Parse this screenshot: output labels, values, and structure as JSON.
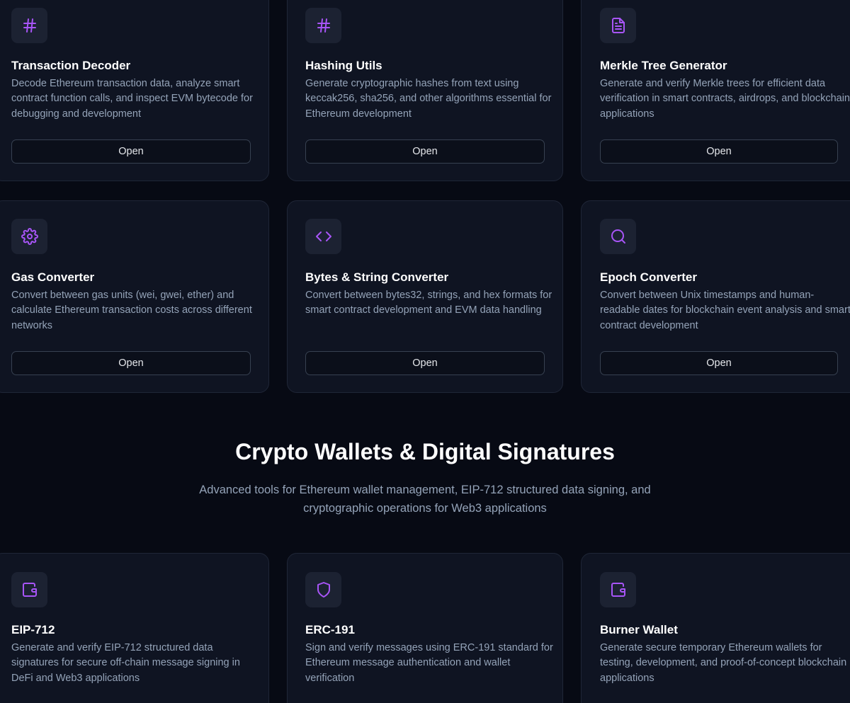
{
  "tools_grid": [
    {
      "title": "Transaction Decoder",
      "description": "Decode Ethereum transaction data, analyze smart contract function calls, and inspect EVM bytecode for debugging and development",
      "button": "Open",
      "icon": "hash-icon"
    },
    {
      "title": "Hashing Utils",
      "description": "Generate cryptographic hashes from text using keccak256, sha256, and other algorithms essential for Ethereum development",
      "button": "Open",
      "icon": "hash-icon"
    },
    {
      "title": "Merkle Tree Generator",
      "description": "Generate and verify Merkle trees for efficient data verification in smart contracts, airdrops, and blockchain applications",
      "button": "Open",
      "icon": "file-text-icon"
    },
    {
      "title": "Gas Converter",
      "description": "Convert between gas units (wei, gwei, ether) and calculate Ethereum transaction costs across different networks",
      "button": "Open",
      "icon": "gear-icon"
    },
    {
      "title": "Bytes & String Converter",
      "description": "Convert between bytes32, strings, and hex formats for smart contract development and EVM data handling",
      "button": "Open",
      "icon": "code-icon"
    },
    {
      "title": "Epoch Converter",
      "description": "Convert between Unix timestamps and human-readable dates for blockchain event analysis and smart contract development",
      "button": "Open",
      "icon": "search-icon"
    }
  ],
  "wallets_section": {
    "title": "Crypto Wallets & Digital Signatures",
    "subtitle_line1": "Advanced tools for Ethereum wallet management, EIP-712 structured data signing, and",
    "subtitle_line2": "cryptographic operations for Web3 applications",
    "cards": [
      {
        "title": "EIP-712",
        "description": "Generate and verify EIP-712 structured data signatures for secure off-chain message signing in DeFi and Web3 applications",
        "icon": "wallet-icon"
      },
      {
        "title": "ERC-191",
        "description": "Sign and verify messages using ERC-191 standard for Ethereum message authentication and wallet verification",
        "icon": "shield-icon"
      },
      {
        "title": "Burner Wallet",
        "description": "Generate secure temporary Ethereum wallets for testing, development, and proof-of-concept blockchain applications",
        "icon": "wallet-icon"
      }
    ]
  },
  "colors": {
    "background": "#070a14",
    "card": "#0f1422",
    "accent": "#a855f7",
    "text_muted": "#94a3b8"
  }
}
